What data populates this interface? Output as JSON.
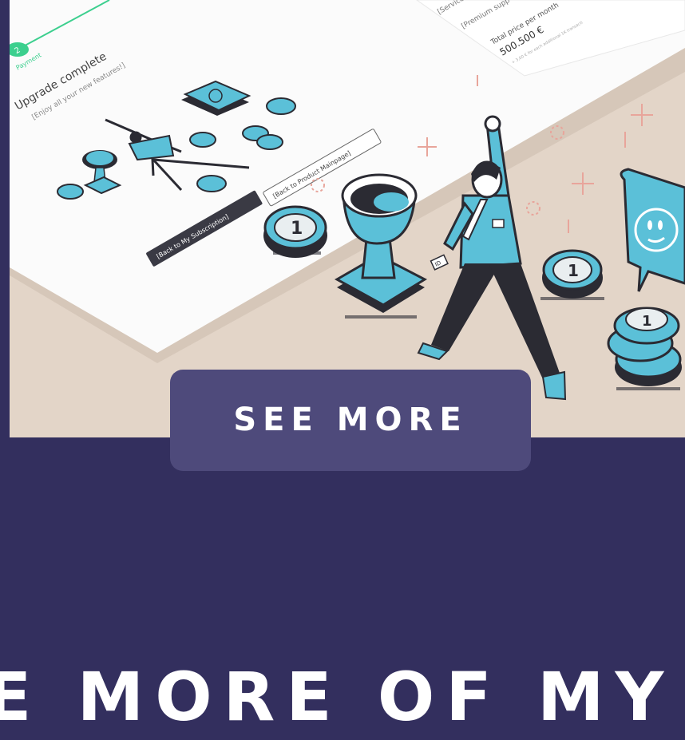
{
  "hero": {
    "step_number": "2",
    "step_label": "Payment",
    "upgrade_title": "Upgrade complete",
    "upgrade_subtitle": "[Enjoy all your new features!]",
    "btn_subscription": "[Back to My Subscription]",
    "btn_product": "[Back to Product Mainpage]",
    "service_text": "[Service",
    "premium_text": "[Premium supp",
    "price_label": "Total price per month",
    "price_value": "500.500 €",
    "price_note": "+ 3,00 € for each additional 1K transacti",
    "coin_label": "1",
    "tag_text": "ID"
  },
  "cta": {
    "label": "SEE MORE"
  },
  "footer": {
    "heading": "E MORE OF MY"
  },
  "colors": {
    "page_bg": "#332f5e",
    "button_bg": "#4e4a7b",
    "accent": "#5bc0d8",
    "green": "#3ccf8e",
    "dark": "#2b2b33",
    "beige": "#e3d5c8"
  }
}
